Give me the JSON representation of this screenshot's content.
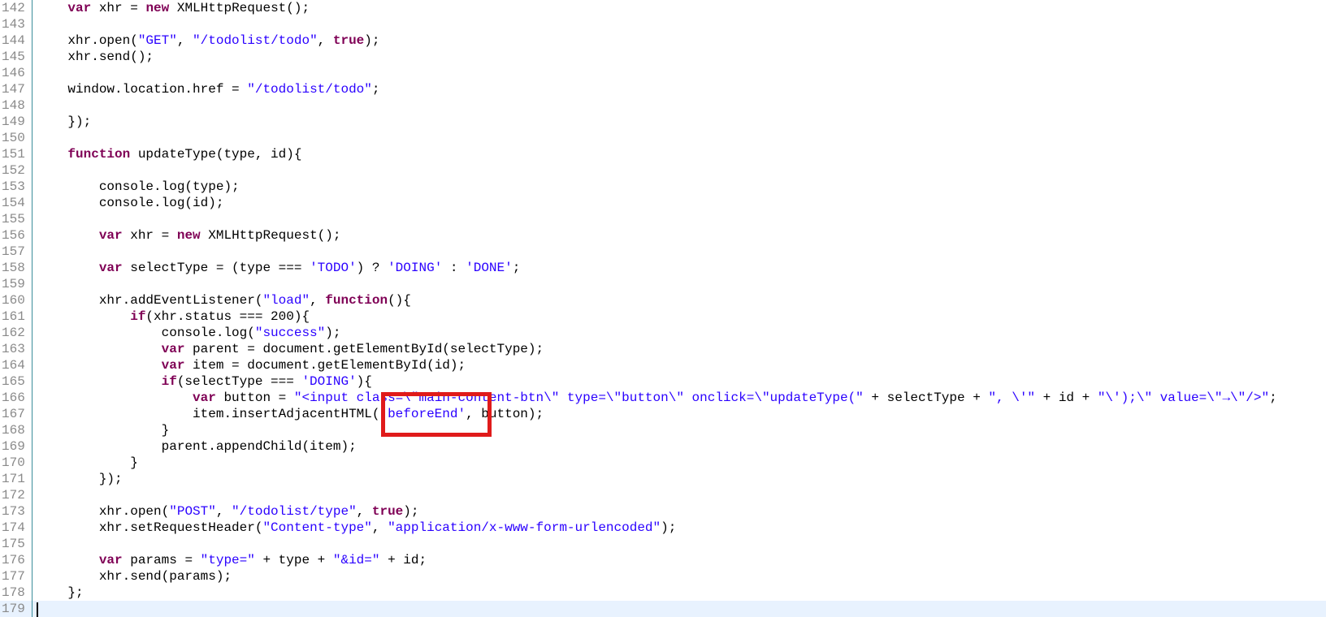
{
  "editor": {
    "current_line": 179,
    "highlight_color": "#e01b1b",
    "keyword_color": "#7f0055",
    "string_color": "#2a00ff",
    "current_line_color": "#e8f2fe",
    "lines": [
      {
        "num": "142",
        "tokens": [
          {
            "t": "    ",
            "k": "plain"
          },
          {
            "t": "var",
            "k": "kw"
          },
          {
            "t": " xhr = ",
            "k": "plain"
          },
          {
            "t": "new",
            "k": "kw"
          },
          {
            "t": " XMLHttpRequest();",
            "k": "plain"
          }
        ]
      },
      {
        "num": "143",
        "tokens": []
      },
      {
        "num": "144",
        "tokens": [
          {
            "t": "    xhr.open(",
            "k": "plain"
          },
          {
            "t": "\"GET\"",
            "k": "str"
          },
          {
            "t": ", ",
            "k": "plain"
          },
          {
            "t": "\"/todolist/todo\"",
            "k": "str"
          },
          {
            "t": ", ",
            "k": "plain"
          },
          {
            "t": "true",
            "k": "kw"
          },
          {
            "t": ");",
            "k": "plain"
          }
        ]
      },
      {
        "num": "145",
        "tokens": [
          {
            "t": "    xhr.send();",
            "k": "plain"
          }
        ]
      },
      {
        "num": "146",
        "tokens": []
      },
      {
        "num": "147",
        "tokens": [
          {
            "t": "    window.location.href = ",
            "k": "plain"
          },
          {
            "t": "\"/todolist/todo\"",
            "k": "str"
          },
          {
            "t": ";",
            "k": "plain"
          }
        ]
      },
      {
        "num": "148",
        "tokens": []
      },
      {
        "num": "149",
        "tokens": [
          {
            "t": "    });",
            "k": "plain"
          }
        ]
      },
      {
        "num": "150",
        "tokens": []
      },
      {
        "num": "151",
        "tokens": [
          {
            "t": "    ",
            "k": "plain"
          },
          {
            "t": "function",
            "k": "kw"
          },
          {
            "t": " updateType(type, id){",
            "k": "plain"
          }
        ]
      },
      {
        "num": "152",
        "tokens": []
      },
      {
        "num": "153",
        "tokens": [
          {
            "t": "        console.log(type);",
            "k": "plain"
          }
        ]
      },
      {
        "num": "154",
        "tokens": [
          {
            "t": "        console.log(id);",
            "k": "plain"
          }
        ]
      },
      {
        "num": "155",
        "tokens": []
      },
      {
        "num": "156",
        "tokens": [
          {
            "t": "        ",
            "k": "plain"
          },
          {
            "t": "var",
            "k": "kw"
          },
          {
            "t": " xhr = ",
            "k": "plain"
          },
          {
            "t": "new",
            "k": "kw"
          },
          {
            "t": " XMLHttpRequest();",
            "k": "plain"
          }
        ]
      },
      {
        "num": "157",
        "tokens": []
      },
      {
        "num": "158",
        "tokens": [
          {
            "t": "        ",
            "k": "plain"
          },
          {
            "t": "var",
            "k": "kw"
          },
          {
            "t": " selectType = (type === ",
            "k": "plain"
          },
          {
            "t": "'TODO'",
            "k": "str"
          },
          {
            "t": ") ? ",
            "k": "plain"
          },
          {
            "t": "'DOING'",
            "k": "str"
          },
          {
            "t": " : ",
            "k": "plain"
          },
          {
            "t": "'DONE'",
            "k": "str"
          },
          {
            "t": ";",
            "k": "plain"
          }
        ]
      },
      {
        "num": "159",
        "tokens": []
      },
      {
        "num": "160",
        "tokens": [
          {
            "t": "        xhr.addEventListener(",
            "k": "plain"
          },
          {
            "t": "\"load\"",
            "k": "str"
          },
          {
            "t": ", ",
            "k": "plain"
          },
          {
            "t": "function",
            "k": "kw"
          },
          {
            "t": "(){",
            "k": "plain"
          }
        ]
      },
      {
        "num": "161",
        "tokens": [
          {
            "t": "            ",
            "k": "plain"
          },
          {
            "t": "if",
            "k": "kw"
          },
          {
            "t": "(xhr.status === 200){",
            "k": "plain"
          }
        ]
      },
      {
        "num": "162",
        "tokens": [
          {
            "t": "                console.log(",
            "k": "plain"
          },
          {
            "t": "\"success\"",
            "k": "str"
          },
          {
            "t": ");",
            "k": "plain"
          }
        ]
      },
      {
        "num": "163",
        "tokens": [
          {
            "t": "                ",
            "k": "plain"
          },
          {
            "t": "var",
            "k": "kw"
          },
          {
            "t": " parent = document.getElementById(selectType);",
            "k": "plain"
          }
        ]
      },
      {
        "num": "164",
        "tokens": [
          {
            "t": "                ",
            "k": "plain"
          },
          {
            "t": "var",
            "k": "kw"
          },
          {
            "t": " item = document.getElementById(id);",
            "k": "plain"
          }
        ]
      },
      {
        "num": "165",
        "tokens": [
          {
            "t": "                ",
            "k": "plain"
          },
          {
            "t": "if",
            "k": "kw"
          },
          {
            "t": "(selectType === ",
            "k": "plain"
          },
          {
            "t": "'DOING'",
            "k": "str"
          },
          {
            "t": "){",
            "k": "plain"
          }
        ]
      },
      {
        "num": "166",
        "tokens": [
          {
            "t": "                    ",
            "k": "plain"
          },
          {
            "t": "var",
            "k": "kw"
          },
          {
            "t": " button = ",
            "k": "plain"
          },
          {
            "t": "\"<input class=\\\"main-content-btn\\\" type=\\\"button\\\" onclick=\\\"updateType(\"",
            "k": "str"
          },
          {
            "t": " + selectType + ",
            "k": "plain"
          },
          {
            "t": "\", \\'\"",
            "k": "str"
          },
          {
            "t": " + id + ",
            "k": "plain"
          },
          {
            "t": "\"\\');\\\" value=\\\"→\\\"/>\"",
            "k": "str"
          },
          {
            "t": ";",
            "k": "plain"
          }
        ]
      },
      {
        "num": "167",
        "tokens": [
          {
            "t": "                    item.insertAdjacentHTML(",
            "k": "plain"
          },
          {
            "t": "'beforeEnd'",
            "k": "str"
          },
          {
            "t": ", button);",
            "k": "plain"
          }
        ]
      },
      {
        "num": "168",
        "tokens": [
          {
            "t": "                }",
            "k": "plain"
          }
        ]
      },
      {
        "num": "169",
        "tokens": [
          {
            "t": "                parent.appendChild(item);",
            "k": "plain"
          }
        ]
      },
      {
        "num": "170",
        "tokens": [
          {
            "t": "            }",
            "k": "plain"
          }
        ]
      },
      {
        "num": "171",
        "tokens": [
          {
            "t": "        });",
            "k": "plain"
          }
        ]
      },
      {
        "num": "172",
        "tokens": []
      },
      {
        "num": "173",
        "tokens": [
          {
            "t": "        xhr.open(",
            "k": "plain"
          },
          {
            "t": "\"POST\"",
            "k": "str"
          },
          {
            "t": ", ",
            "k": "plain"
          },
          {
            "t": "\"/todolist/type\"",
            "k": "str"
          },
          {
            "t": ", ",
            "k": "plain"
          },
          {
            "t": "true",
            "k": "kw"
          },
          {
            "t": ");",
            "k": "plain"
          }
        ]
      },
      {
        "num": "174",
        "tokens": [
          {
            "t": "        xhr.setRequestHeader(",
            "k": "plain"
          },
          {
            "t": "\"Content-type\"",
            "k": "str"
          },
          {
            "t": ", ",
            "k": "plain"
          },
          {
            "t": "\"application/x-www-form-urlencoded\"",
            "k": "str"
          },
          {
            "t": ");",
            "k": "plain"
          }
        ]
      },
      {
        "num": "175",
        "tokens": []
      },
      {
        "num": "176",
        "tokens": [
          {
            "t": "        ",
            "k": "plain"
          },
          {
            "t": "var",
            "k": "kw"
          },
          {
            "t": " params = ",
            "k": "plain"
          },
          {
            "t": "\"type=\"",
            "k": "str"
          },
          {
            "t": " + type + ",
            "k": "plain"
          },
          {
            "t": "\"&id=\"",
            "k": "str"
          },
          {
            "t": " + id;",
            "k": "plain"
          }
        ]
      },
      {
        "num": "177",
        "tokens": [
          {
            "t": "        xhr.send(params);",
            "k": "plain"
          }
        ]
      },
      {
        "num": "178",
        "tokens": [
          {
            "t": "    };",
            "k": "plain"
          }
        ]
      },
      {
        "num": "179",
        "tokens": []
      }
    ]
  }
}
